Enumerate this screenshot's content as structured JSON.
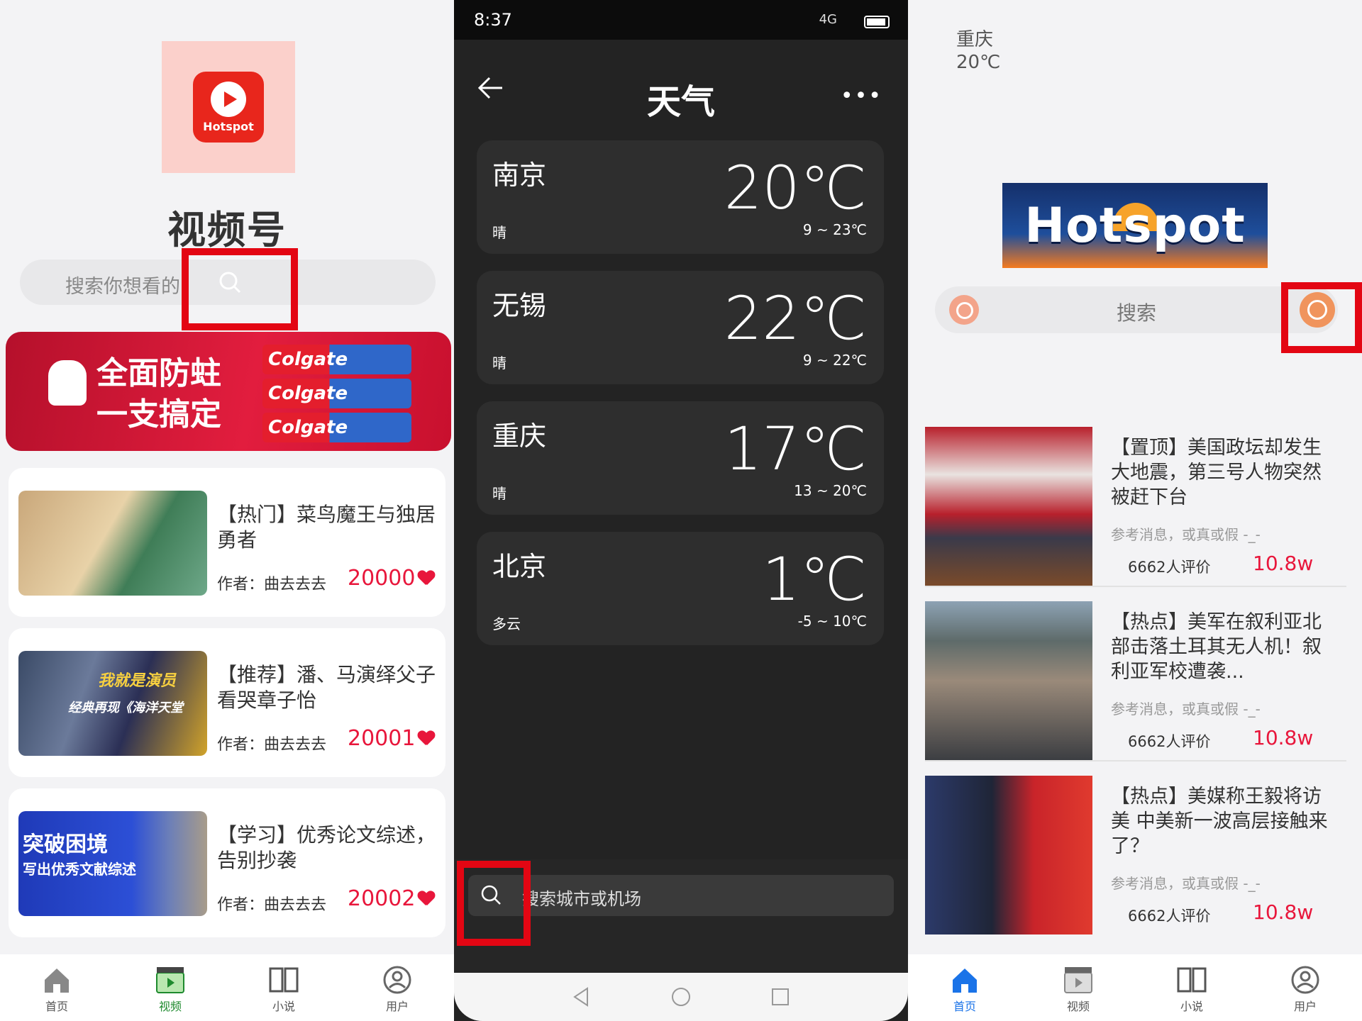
{
  "left": {
    "app_logo_text": "Hotspot",
    "app_title": "视频号",
    "search_placeholder": "搜索你想看的",
    "banner": {
      "line1": "全面防蛀",
      "line2": "一支搞定",
      "product": "Colgate"
    },
    "videos": [
      {
        "title": "【热门】菜鸟魔王与独居勇者",
        "author": "作者：曲去去去",
        "likes": "20000"
      },
      {
        "title": "【推荐】潘、马演绎父子看哭章子怡",
        "author": "作者：曲去去去",
        "likes": "20001"
      },
      {
        "title": "【学习】优秀论文综述，告别抄袭",
        "author": "作者：曲去去去",
        "likes": "20002"
      }
    ],
    "thumb_texts": {
      "v2_a": "我就是演员",
      "v2_b": "经典再现《海洋天堂",
      "v3_a": "突破困境",
      "v3_b": "写出优秀文献综述"
    },
    "tabs": [
      {
        "label": "首页",
        "icon": "home-icon"
      },
      {
        "label": "视频",
        "icon": "video-icon"
      },
      {
        "label": "小说",
        "icon": "book-icon"
      },
      {
        "label": "用户",
        "icon": "user-icon"
      }
    ]
  },
  "middle": {
    "status": {
      "time": "8:37",
      "signal": "4G"
    },
    "header": {
      "title": "天气",
      "more": "•••"
    },
    "cities": [
      {
        "name": "南京",
        "temp": "20℃",
        "cond": "晴",
        "range": "9 ~ 23℃"
      },
      {
        "name": "无锡",
        "temp": "22℃",
        "cond": "晴",
        "range": "9 ~ 22℃"
      },
      {
        "name": "重庆",
        "temp": "17℃",
        "cond": "晴",
        "range": "13 ~ 20℃"
      },
      {
        "name": "北京",
        "temp": "1℃",
        "cond": "多云",
        "range": "-5 ~ 10℃"
      }
    ],
    "search_placeholder": "搜索城市或机场"
  },
  "right": {
    "location": {
      "city": "重庆",
      "temp": "20℃"
    },
    "logo_text": "Hotspot",
    "search_placeholder": "搜索",
    "news": [
      {
        "title": "【置顶】美国政坛却发生大地震，第三号人物突然被赶下台",
        "source": "参考消息，或真或假 -_-",
        "comments": "6662人评价",
        "views": "10.8w"
      },
      {
        "title": "【热点】美军在叙利亚北部击落土耳其无人机！叙利亚军校遭袭...",
        "source": "参考消息，或真或假 -_-",
        "comments": "6662人评价",
        "views": "10.8w"
      },
      {
        "title": "【热点】美媒称王毅将访美 中美新一波高层接触来了？",
        "source": "参考消息，或真或假 -_-",
        "comments": "6662人评价",
        "views": "10.8w"
      }
    ],
    "tabs": [
      {
        "label": "首页",
        "icon": "home-icon"
      },
      {
        "label": "视频",
        "icon": "video-icon"
      },
      {
        "label": "小说",
        "icon": "book-icon"
      },
      {
        "label": "用户",
        "icon": "user-icon"
      }
    ]
  },
  "colors": {
    "accent_red": "#e8163b",
    "highlight_box": "#e30613",
    "tab_active_blue": "#1a73e8",
    "weather_bg": "#232323"
  }
}
